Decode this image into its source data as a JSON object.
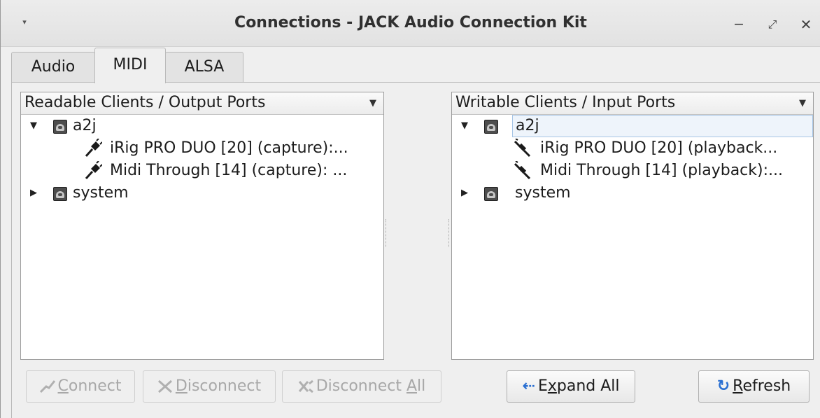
{
  "window": {
    "title": "Connections - JACK Audio Connection Kit",
    "menu_glyph": "▾",
    "minimize_glyph": "‒",
    "maximize_glyph": "⤢",
    "close_glyph": "✕"
  },
  "tabs": [
    {
      "label": "Audio",
      "active": false
    },
    {
      "label": "MIDI",
      "active": true
    },
    {
      "label": "ALSA",
      "active": false
    }
  ],
  "left_pane": {
    "header": "Readable Clients / Output Ports",
    "clients": [
      {
        "name": "a2j",
        "expanded": true,
        "ports": [
          "iRig PRO DUO [20] (capture):...",
          "Midi Through [14] (capture): ..."
        ]
      },
      {
        "name": "system",
        "expanded": false,
        "ports": []
      }
    ]
  },
  "right_pane": {
    "header": "Writable Clients / Input Ports",
    "clients": [
      {
        "name": "a2j",
        "expanded": true,
        "selected": true,
        "ports": [
          "iRig PRO DUO [20] (playback...",
          "Midi Through [14] (playback):..."
        ]
      },
      {
        "name": "system",
        "expanded": false,
        "ports": []
      }
    ]
  },
  "buttons": {
    "connect": {
      "mnemonic": "C",
      "rest": "onnect",
      "enabled": false,
      "icon": "plug-connect-icon"
    },
    "disconnect": {
      "mnemonic": "D",
      "rest": "isconnect",
      "enabled": false,
      "icon": "plug-disconnect-icon"
    },
    "disconnect_all": {
      "prefix": "Disconnect ",
      "mnemonic": "A",
      "rest": "ll",
      "enabled": false,
      "icon": "disconnect-all-icon"
    },
    "expand_all": {
      "prefix": "E",
      "mnemonic": "x",
      "rest": "pand All",
      "enabled": true,
      "icon": "expand-arrow-icon"
    },
    "refresh": {
      "mnemonic": "R",
      "rest": "efresh",
      "enabled": true,
      "icon": "refresh-icon"
    }
  },
  "colors": {
    "accent_blue": "#2a6fd1",
    "selection_bg": "#eef4fb"
  }
}
